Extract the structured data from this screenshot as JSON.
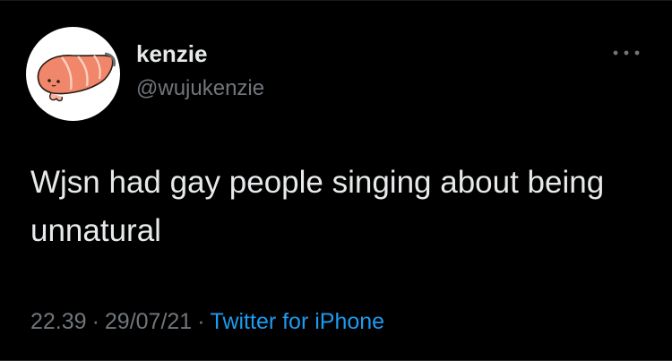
{
  "user": {
    "display_name": "kenzie",
    "handle": "@wujukenzie",
    "avatar_icon": "salmon-sushi-icon"
  },
  "more_icon": "more-dots-icon",
  "tweet": {
    "text": "Wjsn had gay people singing about being unnatural"
  },
  "meta": {
    "time": "22.39",
    "date": "29/07/21",
    "separator": "·",
    "source": "Twitter for iPhone"
  },
  "colors": {
    "background": "#000000",
    "primary_text": "#e7e9ea",
    "secondary_text": "#71767b",
    "link": "#1d9bf0"
  }
}
